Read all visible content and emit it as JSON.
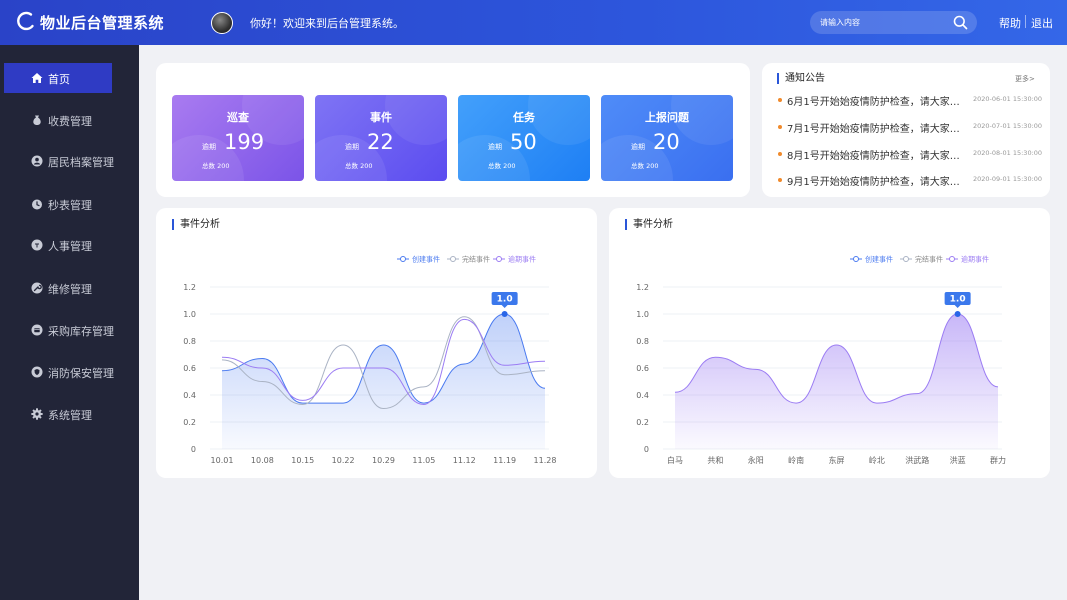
{
  "header": {
    "app_title": "物业后台管理系统",
    "welcome": "你好！欢迎来到后台管理系统。",
    "search_placeholder": "请输入内容",
    "help": "帮助",
    "logout": "退出"
  },
  "sidebar": {
    "items": [
      {
        "label": "首页",
        "icon": "home-icon",
        "active": true
      },
      {
        "label": "收费管理",
        "icon": "money-bag-icon"
      },
      {
        "label": "居民档案管理",
        "icon": "user-profile-icon"
      },
      {
        "label": "秒表管理",
        "icon": "stopwatch-icon"
      },
      {
        "label": "人事管理",
        "icon": "people-icon"
      },
      {
        "label": "维修管理",
        "icon": "wrench-icon"
      },
      {
        "label": "采购库存管理",
        "icon": "box-icon"
      },
      {
        "label": "消防保安管理",
        "icon": "shield-icon"
      },
      {
        "label": "系统管理",
        "icon": "gear-icon"
      }
    ]
  },
  "stats": [
    {
      "title": "巡查",
      "sub": "逾期",
      "value": "199",
      "total": "总数 200"
    },
    {
      "title": "事件",
      "sub": "逾期",
      "value": "22",
      "total": "总数 200"
    },
    {
      "title": "任务",
      "sub": "逾期",
      "value": "50",
      "total": "总数 200"
    },
    {
      "title": "上报问题",
      "sub": "逾期",
      "value": "20",
      "total": "总数 200"
    }
  ],
  "notices": {
    "title": "通知公告",
    "more": "更多>",
    "items": [
      {
        "text": "6月1号开始始疫情防护检查，请大家…",
        "date": "2020-06-01 15:30:00"
      },
      {
        "text": "7月1号开始始疫情防护检查，请大家…",
        "date": "2020-07-01 15:30:00"
      },
      {
        "text": "8月1号开始始疫情防护检查，请大家…",
        "date": "2020-08-01 15:30:00"
      },
      {
        "text": "9月1号开始始疫情防护检查，请大家…",
        "date": "2020-09-01 15:30:00"
      }
    ]
  },
  "colors": {
    "accent": "#2a56d8",
    "tile_1": [
      "#a97bf0",
      "#7b54e8"
    ],
    "tile_2": [
      "#7f74f4",
      "#5b4cf0"
    ],
    "tile_3": [
      "#43a0fb",
      "#1e7ff4"
    ],
    "tile_4": [
      "#4f8cf8",
      "#3a6ff0"
    ],
    "series_blue": "#4a7af0",
    "series_gray": "#aab3c4",
    "series_purple": "#9b7cf3"
  },
  "chart_data": [
    {
      "type": "line",
      "title": "事件分析",
      "categories": [
        "10.01",
        "10.08",
        "10.15",
        "10.22",
        "10.29",
        "11.05",
        "11.12",
        "11.19",
        "11.28"
      ],
      "ylim": [
        0,
        1.2
      ],
      "yticks": [
        "0",
        "0.2",
        "0.4",
        "0.6",
        "0.8",
        "1.0",
        "1.2"
      ],
      "series": [
        {
          "name": "创建事件",
          "values": [
            0.58,
            0.67,
            0.34,
            0.34,
            0.77,
            0.34,
            0.63,
            1.0,
            0.45
          ],
          "area": true
        },
        {
          "name": "完结事件",
          "values": [
            0.66,
            0.5,
            0.33,
            0.77,
            0.3,
            0.46,
            0.98,
            0.55,
            0.58
          ]
        },
        {
          "name": "逾期事件",
          "values": [
            0.68,
            0.6,
            0.36,
            0.6,
            0.6,
            0.33,
            0.96,
            0.62,
            0.65
          ]
        }
      ],
      "tooltip": {
        "index": 7,
        "label": "1.0"
      },
      "legend_position": "top-right",
      "grid": true
    },
    {
      "type": "area",
      "title": "事件分析",
      "categories": [
        "白马",
        "共和",
        "永阳",
        "岭南",
        "东屏",
        "岭北",
        "洪武路",
        "洪蓝",
        "群力"
      ],
      "ylim": [
        0,
        1.2
      ],
      "yticks": [
        "0",
        "0.2",
        "0.4",
        "0.6",
        "0.8",
        "1.0",
        "1.2"
      ],
      "series": [
        {
          "name": "创建事件",
          "values": [],
          "area": false
        },
        {
          "name": "完结事件",
          "values": [],
          "area": false
        },
        {
          "name": "逾期事件",
          "values": [
            0.42,
            0.68,
            0.59,
            0.34,
            0.77,
            0.34,
            0.41,
            1.0,
            0.46
          ],
          "area": true
        }
      ],
      "tooltip": {
        "index": 7,
        "label": "1.0"
      },
      "legend_position": "top-right",
      "grid": true
    }
  ]
}
